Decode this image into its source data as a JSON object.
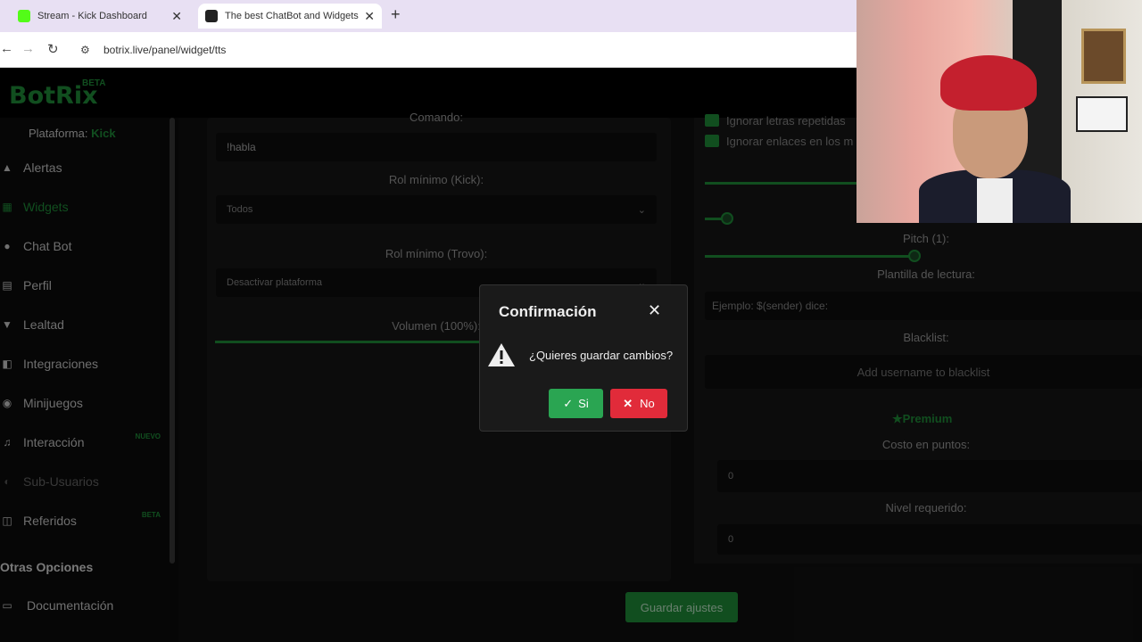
{
  "browser": {
    "tabs": [
      {
        "title": "Stream - Kick Dashboard",
        "icon": "kick-favicon"
      },
      {
        "title": "The best ChatBot and Widgets",
        "icon": "botrix-favicon"
      }
    ],
    "url": "botrix.live/panel/widget/tts"
  },
  "app": {
    "logo": "BotRix",
    "logo_badge": "BETA",
    "platform_label": "Plataforma:",
    "platform_value": "Kick",
    "brand_color": "#1f8f3a"
  },
  "sidebar": {
    "items": [
      {
        "label": "Alertas",
        "icon": "bell-icon"
      },
      {
        "label": "Widgets",
        "icon": "widgets-icon",
        "active": true
      },
      {
        "label": "Chat Bot",
        "icon": "robot-icon"
      },
      {
        "label": "Perfil",
        "icon": "id-card-icon"
      },
      {
        "label": "Lealtad",
        "icon": "trophy-icon"
      },
      {
        "label": "Integraciones",
        "icon": "plug-icon"
      },
      {
        "label": "Minijuegos",
        "icon": "gamepad-icon"
      },
      {
        "label": "Interacción",
        "icon": "music-icon",
        "badge": "NUEVO"
      },
      {
        "label": "Sub-Usuarios",
        "icon": "users-icon",
        "disabled": true
      },
      {
        "label": "Referidos",
        "icon": "share-icon",
        "badge": "BETA"
      }
    ],
    "section_title": "Otras Opciones",
    "docs_label": "Documentación"
  },
  "form_left": {
    "command_label": "Comando:",
    "command_value": "!habla",
    "kick_role_label": "Rol mínimo (Kick):",
    "kick_role_value": "Todos",
    "trovo_role_label": "Rol mínimo (Trovo):",
    "trovo_role_value": "Desactivar plataforma",
    "volume_label": "Volumen (100%):"
  },
  "form_right": {
    "ignore_repeated": "Ignorar letras repetidas",
    "ignore_links": "Ignorar enlaces en los m",
    "pitch_label": "Pitch (1):",
    "template_label": "Plantilla de lectura:",
    "template_placeholder": "Ejemplo: $(sender) dice:",
    "blacklist_label": "Blacklist:",
    "blacklist_placeholder": "Add username to blacklist",
    "premium_label": "Premium",
    "cost_label": "Costo en puntos:",
    "cost_value": "0",
    "level_label": "Nivel requerido:",
    "level_value": "0"
  },
  "save_button": "Guardar ajustes",
  "dialog": {
    "title": "Confirmación",
    "message": "¿Quieres guardar cambios?",
    "yes_label": "Si",
    "no_label": "No"
  }
}
